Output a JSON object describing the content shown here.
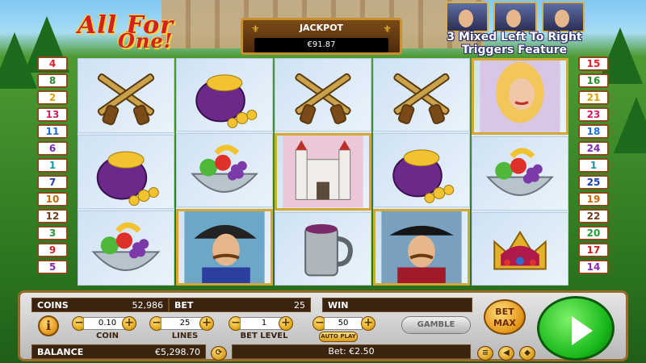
{
  "game": {
    "title_line1": "All For",
    "title_line2": "One!",
    "jackpot_label": "JACKPOT",
    "jackpot_value": "€91.87",
    "feature_text_line1": "3 Mixed Left To Right",
    "feature_text_line2": "Triggers Feature"
  },
  "paylines": {
    "left": [
      "4",
      "8",
      "2",
      "13",
      "11",
      "6",
      "1",
      "7",
      "10",
      "12",
      "3",
      "9",
      "5"
    ],
    "right": [
      "15",
      "16",
      "21",
      "23",
      "18",
      "24",
      "1",
      "25",
      "19",
      "22",
      "20",
      "17",
      "14"
    ],
    "colors": [
      "#e0202a",
      "#2e8a2e",
      "#d9a20a",
      "#cc1f6a",
      "#1e6fd0",
      "#7a2ab0",
      "#149aa0",
      "#1e3fae",
      "#c46a00",
      "#6e3c1c",
      "#2a9a3a",
      "#c62020",
      "#8a2ab0"
    ]
  },
  "reels": [
    [
      "crossed-pistols",
      "gold-sack",
      "fruit-bowl"
    ],
    [
      "gold-sack",
      "fruit-bowl",
      "musketeer-mustache"
    ],
    [
      "crossed-pistols",
      "castle",
      "pewter-mug"
    ],
    [
      "crossed-pistols",
      "gold-sack",
      "musketeer-black-hat"
    ],
    [
      "lady-blonde",
      "fruit-bowl",
      "royal-crown"
    ]
  ],
  "panel": {
    "coins_label": "COINS",
    "coins_value": "52,986",
    "bet_label": "BET",
    "bet_value": "25",
    "win_label": "WIN",
    "win_value": "",
    "coin_value": "0.10",
    "coin_label": "COIN",
    "lines_value": "25",
    "lines_label": "LINES",
    "bet_level_value": "1",
    "bet_level_label": "BET LEVEL",
    "autoplay_value": "50",
    "autoplay_label": "AUTO PLAY",
    "gamble_label": "GAMBLE",
    "bet_max_line1": "BET",
    "bet_max_line2": "MAX",
    "balance_label": "BALANCE",
    "balance_value": "€5,298.70",
    "bet_total": "Bet: €2.50",
    "minus": "−",
    "plus": "+"
  }
}
